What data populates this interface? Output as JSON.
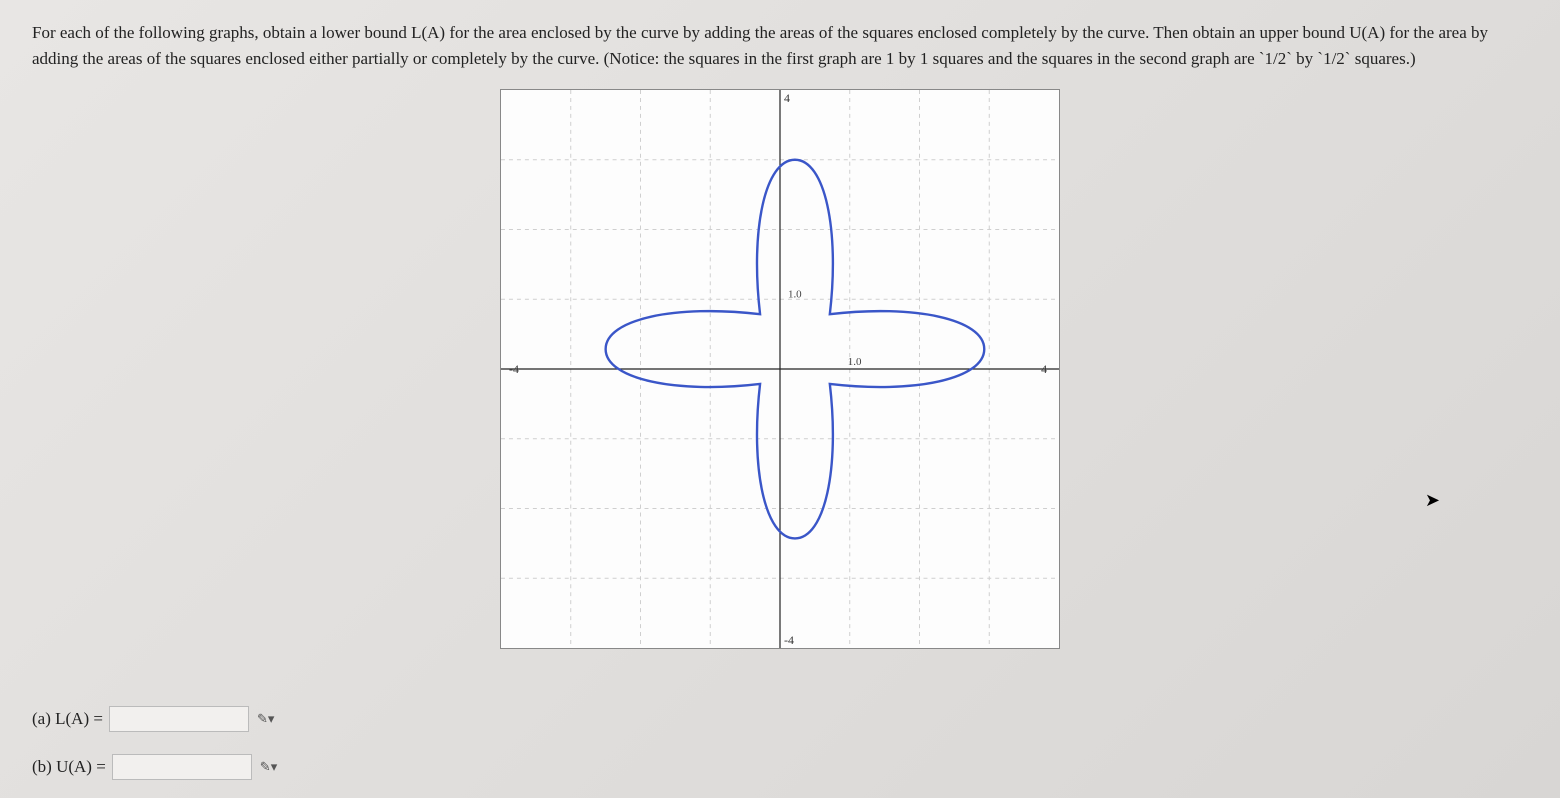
{
  "problem": {
    "text": "For each of the following graphs, obtain a lower bound L(A) for the area enclosed by the curve by adding the areas of the squares enclosed completely by the curve. Then obtain an upper bound U(A) for the area by adding the areas of the squares enclosed either partially or completely by the curve. (Notice: the squares in the first graph are 1 by 1 squares and the squares in the second graph are `1/2` by `1/2` squares.)"
  },
  "graph": {
    "x_min": -4,
    "x_max": 4,
    "y_min": -4,
    "y_max": 4,
    "x_label_left": "-4",
    "x_label_right": "4",
    "y_label_top": "4",
    "y_label_bottom": "-4",
    "tick_label_y": "1.0",
    "tick_label_x": "1.0",
    "grid_step": 1
  },
  "answers": {
    "a_label": "(a) L(A) =",
    "a_value": "",
    "b_label": "(b) U(A) =",
    "b_value": ""
  },
  "icons": {
    "pencil": "✎▾"
  }
}
